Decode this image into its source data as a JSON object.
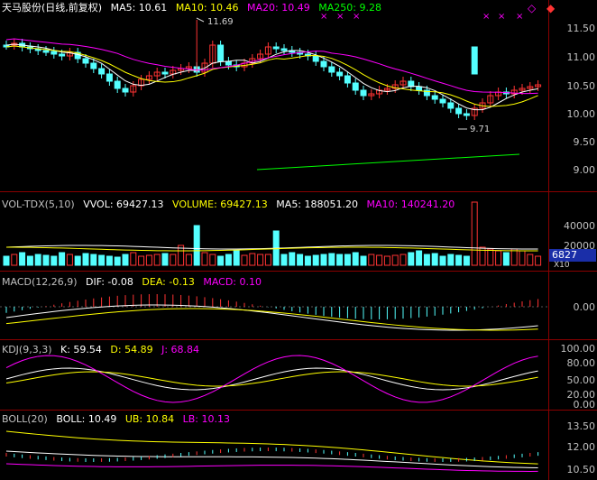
{
  "main": {
    "title": "天马股份(日线,前复权)",
    "ma5": "MA5: 10.61",
    "ma10": "MA10: 10.46",
    "ma20": "MA20: 10.49",
    "ma250": "MA250: 9.28",
    "high_mark": "11.69",
    "low_mark": "9.71",
    "y_labels": [
      "11.50",
      "11.00",
      "10.50",
      "10.00",
      "9.50",
      "9.00"
    ],
    "colors": {
      "ma5": "#ffffff",
      "ma10": "#ffff00",
      "ma20": "#ff00ff",
      "ma250": "#00ff00",
      "up": "#ff3333",
      "down": "#54ffff"
    }
  },
  "volume": {
    "title": "VOL-TDX(5,10)",
    "vvol": "VVOL: 69427.13",
    "volume": "VOLUME: 69427.13",
    "ma5": "MA5: 188051.20",
    "ma10": "MA10: 140241.20",
    "y_labels": [
      "40000",
      "20000"
    ],
    "current": "6827",
    "unit": "X10"
  },
  "macd": {
    "title": "MACD(12,26,9)",
    "dif": "DIF: -0.08",
    "dea": "DEA: -0.13",
    "macd": "MACD: 0.10",
    "y_labels": [
      "0.00"
    ]
  },
  "kdj": {
    "title": "KDJ(9,3,3)",
    "k": "K: 59.54",
    "d": "D: 54.89",
    "j": "J: 68.84",
    "y_labels": [
      "100.00",
      "80.00",
      "50.00",
      "20.00",
      "0.00"
    ]
  },
  "boll": {
    "title": "BOLL(20)",
    "boll": "BOLL: 10.49",
    "ub": "UB: 10.84",
    "lb": "LB: 10.13",
    "y_labels": [
      "13.50",
      "12.00",
      "10.50"
    ]
  }
}
